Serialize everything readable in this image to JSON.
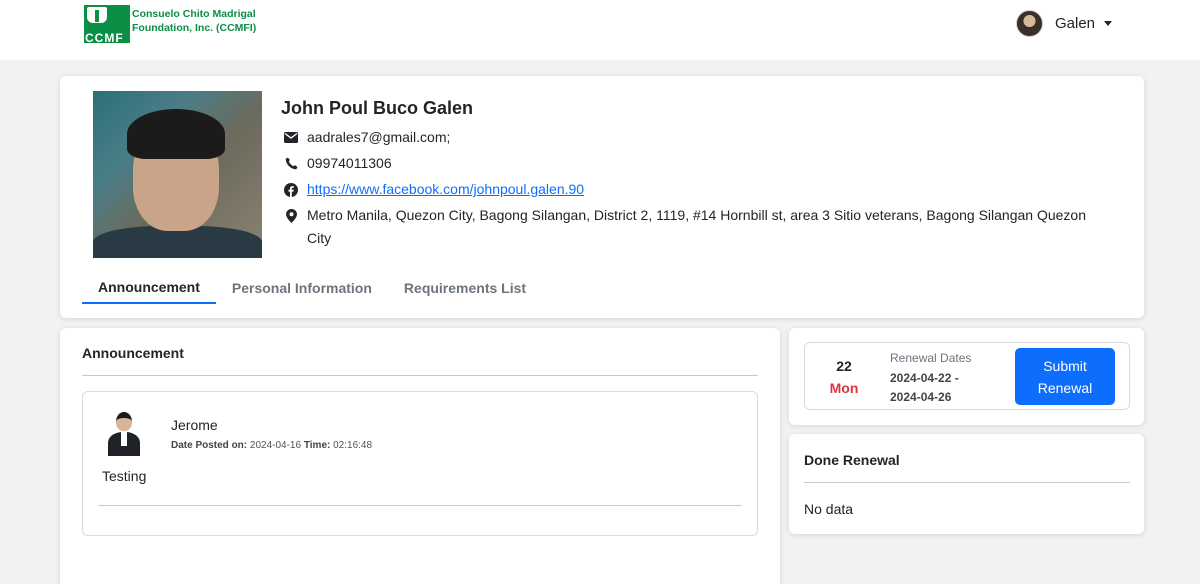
{
  "header": {
    "logo_abbr": "CCMF",
    "logo_line1": "Consuelo  Chito Madrigal",
    "logo_line2": "Foundation, Inc. (CCMFI)",
    "user_name": "Galen"
  },
  "profile": {
    "name": "John Poul Buco Galen",
    "email": "aadrales7@gmail.com;",
    "phone": "09974011306",
    "facebook": "https://www.facebook.com/johnpoul.galen.90",
    "address": "Metro Manila, Quezon City, Bagong Silangan, District 2, 1119, #14 Hornbill st, area 3 Sitio veterans, Bagong Silangan Quezon City",
    "icons": [
      "envelope-icon",
      "phone-icon",
      "facebook-icon",
      "map-marker-icon"
    ]
  },
  "tabs": [
    {
      "label": "Announcement",
      "active": true
    },
    {
      "label": "Personal Information",
      "active": false
    },
    {
      "label": "Requirements List",
      "active": false
    }
  ],
  "announcement": {
    "title": "Announcement",
    "posts": [
      {
        "author": "Jerome",
        "date_label": "Date Posted on:",
        "date": "2024-04-16",
        "time_label": "Time:",
        "time": "02:16:48",
        "body": "Testing"
      }
    ]
  },
  "renewal": {
    "day_number": "22",
    "day_name": "Mon",
    "label": "Renewal Dates",
    "start": "2024-04-22 -",
    "end": "2024-04-26",
    "button_label": "Submit Renewal"
  },
  "done_renewal": {
    "title": "Done Renewal",
    "empty_text": "No data"
  },
  "colors": {
    "brand_green": "#0a8f45",
    "accent_blue": "#0d6efd",
    "day_red": "#dc3545"
  }
}
